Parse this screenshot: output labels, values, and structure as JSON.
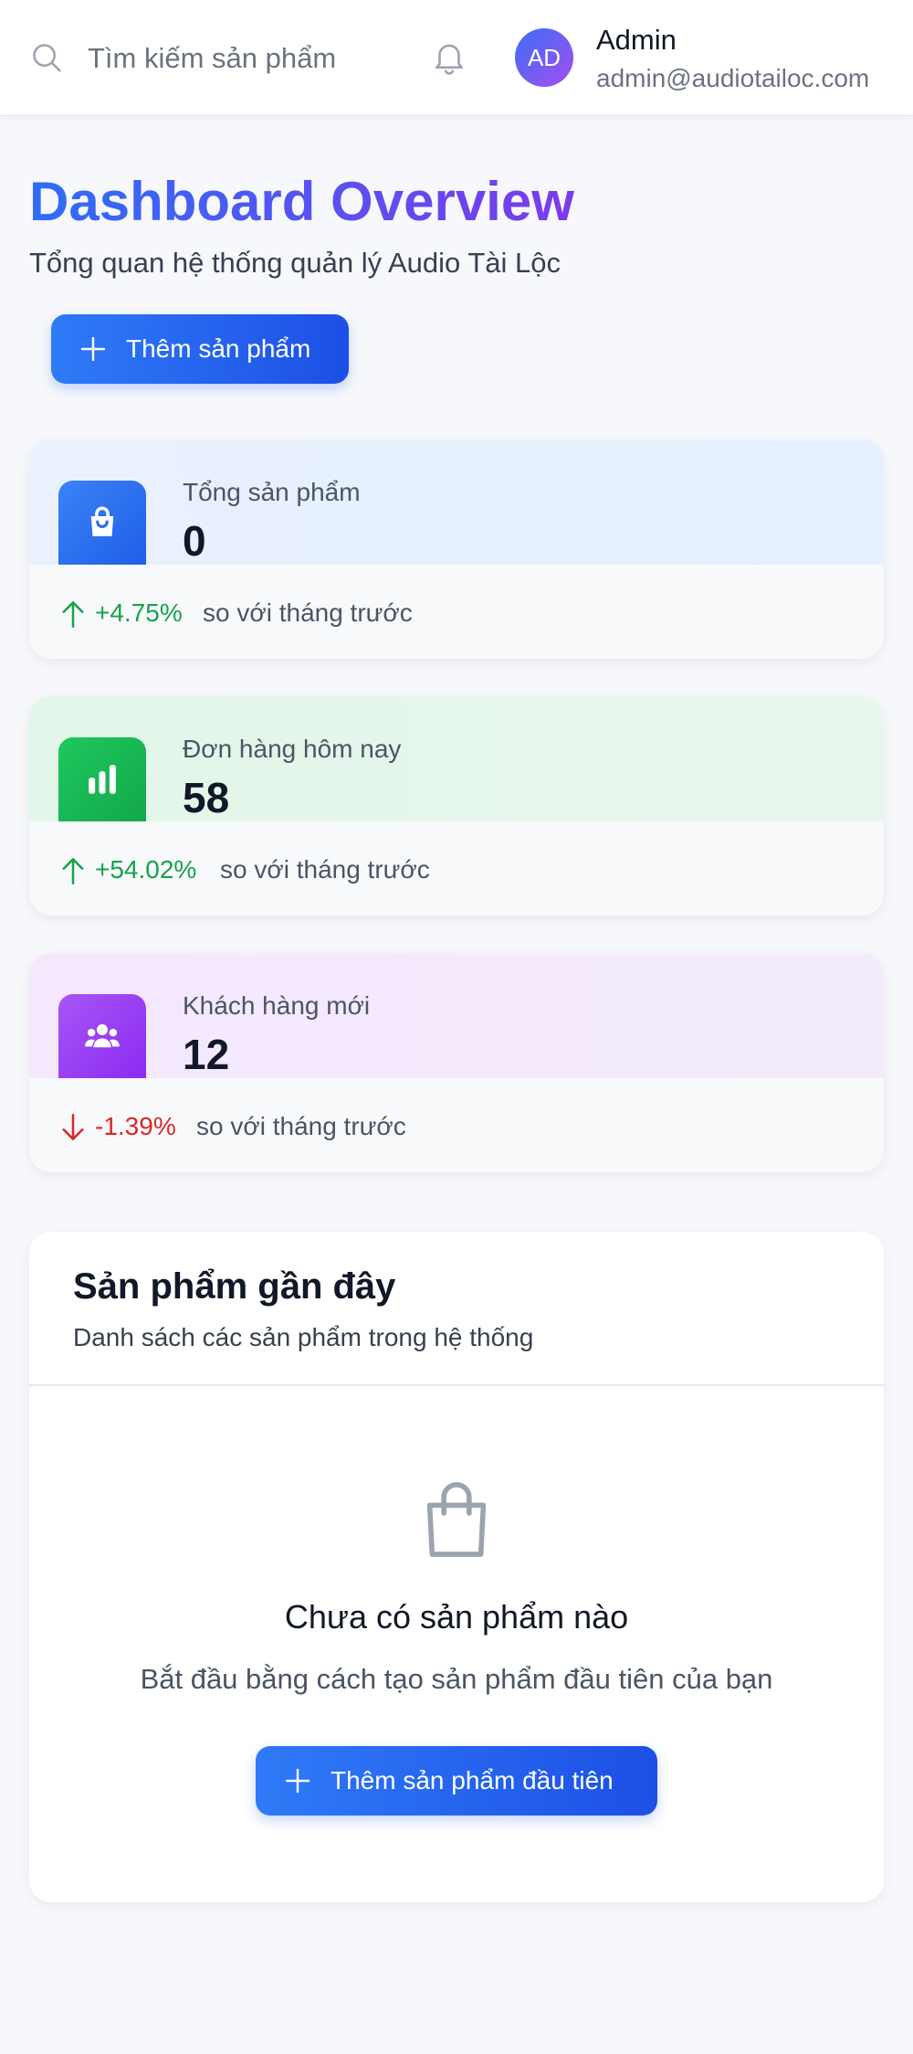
{
  "header": {
    "search_placeholder": "Tìm kiếm sản phẩm...",
    "user": {
      "initials": "AD",
      "name": "Admin",
      "email": "admin@audiotailoc.com"
    }
  },
  "page": {
    "title": "Dashboard Overview",
    "subtitle": "Tổng quan hệ thống quản lý Audio Tài Lộc",
    "add_button_label": "Thêm sản phẩm"
  },
  "stats": [
    {
      "label": "Tổng sản phẩm",
      "value": "0",
      "change": "+4.75%",
      "direction": "up",
      "comparison": "so với tháng trước",
      "icon": "shopping-bag-icon",
      "color": "#2563eb"
    },
    {
      "label": "Đơn hàng hôm nay",
      "value": "58",
      "change": "+54.02%",
      "direction": "up",
      "comparison": "so với tháng trước",
      "icon": "bar-chart-icon",
      "color": "#16a34a"
    },
    {
      "label": "Khách hàng mới",
      "value": "12",
      "change": "-1.39%",
      "direction": "down",
      "comparison": "so với tháng trước",
      "icon": "users-icon",
      "color": "#9333ea"
    }
  ],
  "recent_products": {
    "title": "Sản phẩm gần đây",
    "subtitle": "Danh sách các sản phẩm trong hệ thống",
    "empty_title": "Chưa có sản phẩm nào",
    "empty_text": "Bắt đầu bằng cách tạo sản phẩm đầu tiên của bạn",
    "empty_button_label": "Thêm sản phẩm đầu tiên"
  },
  "colors": {
    "accent": "#2563eb",
    "positive": "#16a34a",
    "negative": "#dc2626"
  }
}
